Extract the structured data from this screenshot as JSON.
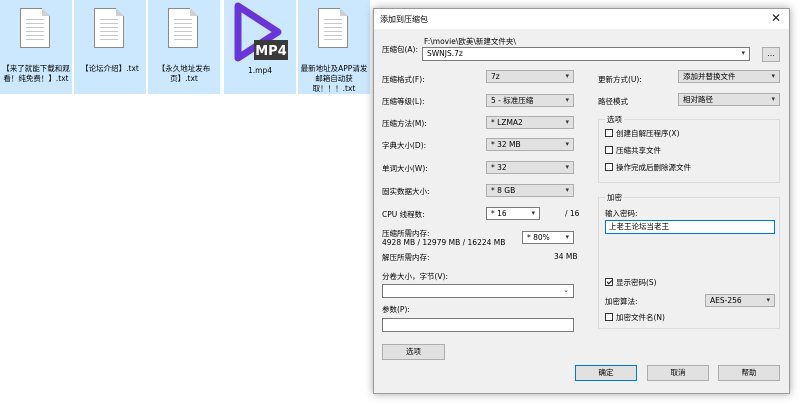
{
  "desktop": {
    "files": [
      {
        "name": "【来了就能下载和观看！纯免费！】.txt",
        "type": "txt"
      },
      {
        "name": "【论坛介绍】.txt",
        "type": "txt"
      },
      {
        "name": "【永久地址发布页】.txt",
        "type": "txt"
      },
      {
        "name": "1.mp4",
        "type": "mp4",
        "badge": "MP4"
      },
      {
        "name": "最新地址及APP请发邮箱自动获取！！！.txt",
        "type": "txt"
      }
    ]
  },
  "dialog": {
    "title": "添加到压缩包",
    "close_glyph": "✕",
    "archive": {
      "label": "压缩包(A):",
      "path": "F:\\movie\\欧美\\新建文件夹\\",
      "name": "SWNJS.7z",
      "browse_label": "..."
    },
    "left": {
      "format": {
        "label": "压缩格式(F):",
        "value": "7z"
      },
      "level": {
        "label": "压缩等级(L):",
        "value": "5 - 标准压缩"
      },
      "method": {
        "label": "压缩方法(M):",
        "value": "* LZMA2"
      },
      "dict": {
        "label": "字典大小(D):",
        "value": "* 32 MB"
      },
      "word": {
        "label": "单词大小(W):",
        "value": "* 32"
      },
      "solid": {
        "label": "固实数据大小:",
        "value": "* 8 GB"
      },
      "cpu": {
        "label": "CPU 线程数:",
        "value": "* 16",
        "total": "/ 16"
      },
      "mem_compress": {
        "label": "压缩所需内存:",
        "detail": "4928 MB / 12979 MB / 16224 MB",
        "percent": "* 80%"
      },
      "mem_decompress": {
        "label": "解压所需内存:",
        "value": "34 MB"
      },
      "split": {
        "label": "分卷大小，字节(V):",
        "value": ""
      },
      "params": {
        "label": "参数(P):",
        "value": ""
      },
      "options_button": "选项"
    },
    "right": {
      "update": {
        "label": "更新方式(U):",
        "value": "添加并替换文件"
      },
      "path_mode": {
        "label": "路径模式",
        "value": "相对路径"
      },
      "options_group": {
        "title": "选项",
        "sfx": "创建自解压程序(X)",
        "shared": "压缩共享文件",
        "delete": "操作完成后删除源文件"
      },
      "encrypt_group": {
        "title": "加密",
        "password_label": "输入密码:",
        "password_value": "上老王论坛当老王",
        "show_password": "显示密码(S)",
        "method_label": "加密算法:",
        "method_value": "AES-256",
        "encrypt_names": "加密文件名(N)"
      }
    },
    "buttons": {
      "ok": "确定",
      "cancel": "取消",
      "help": "帮助"
    }
  },
  "colors": {
    "accent": "#0078d7",
    "selection": "#cce8ff",
    "mp4_purple": "#6a35d8"
  }
}
